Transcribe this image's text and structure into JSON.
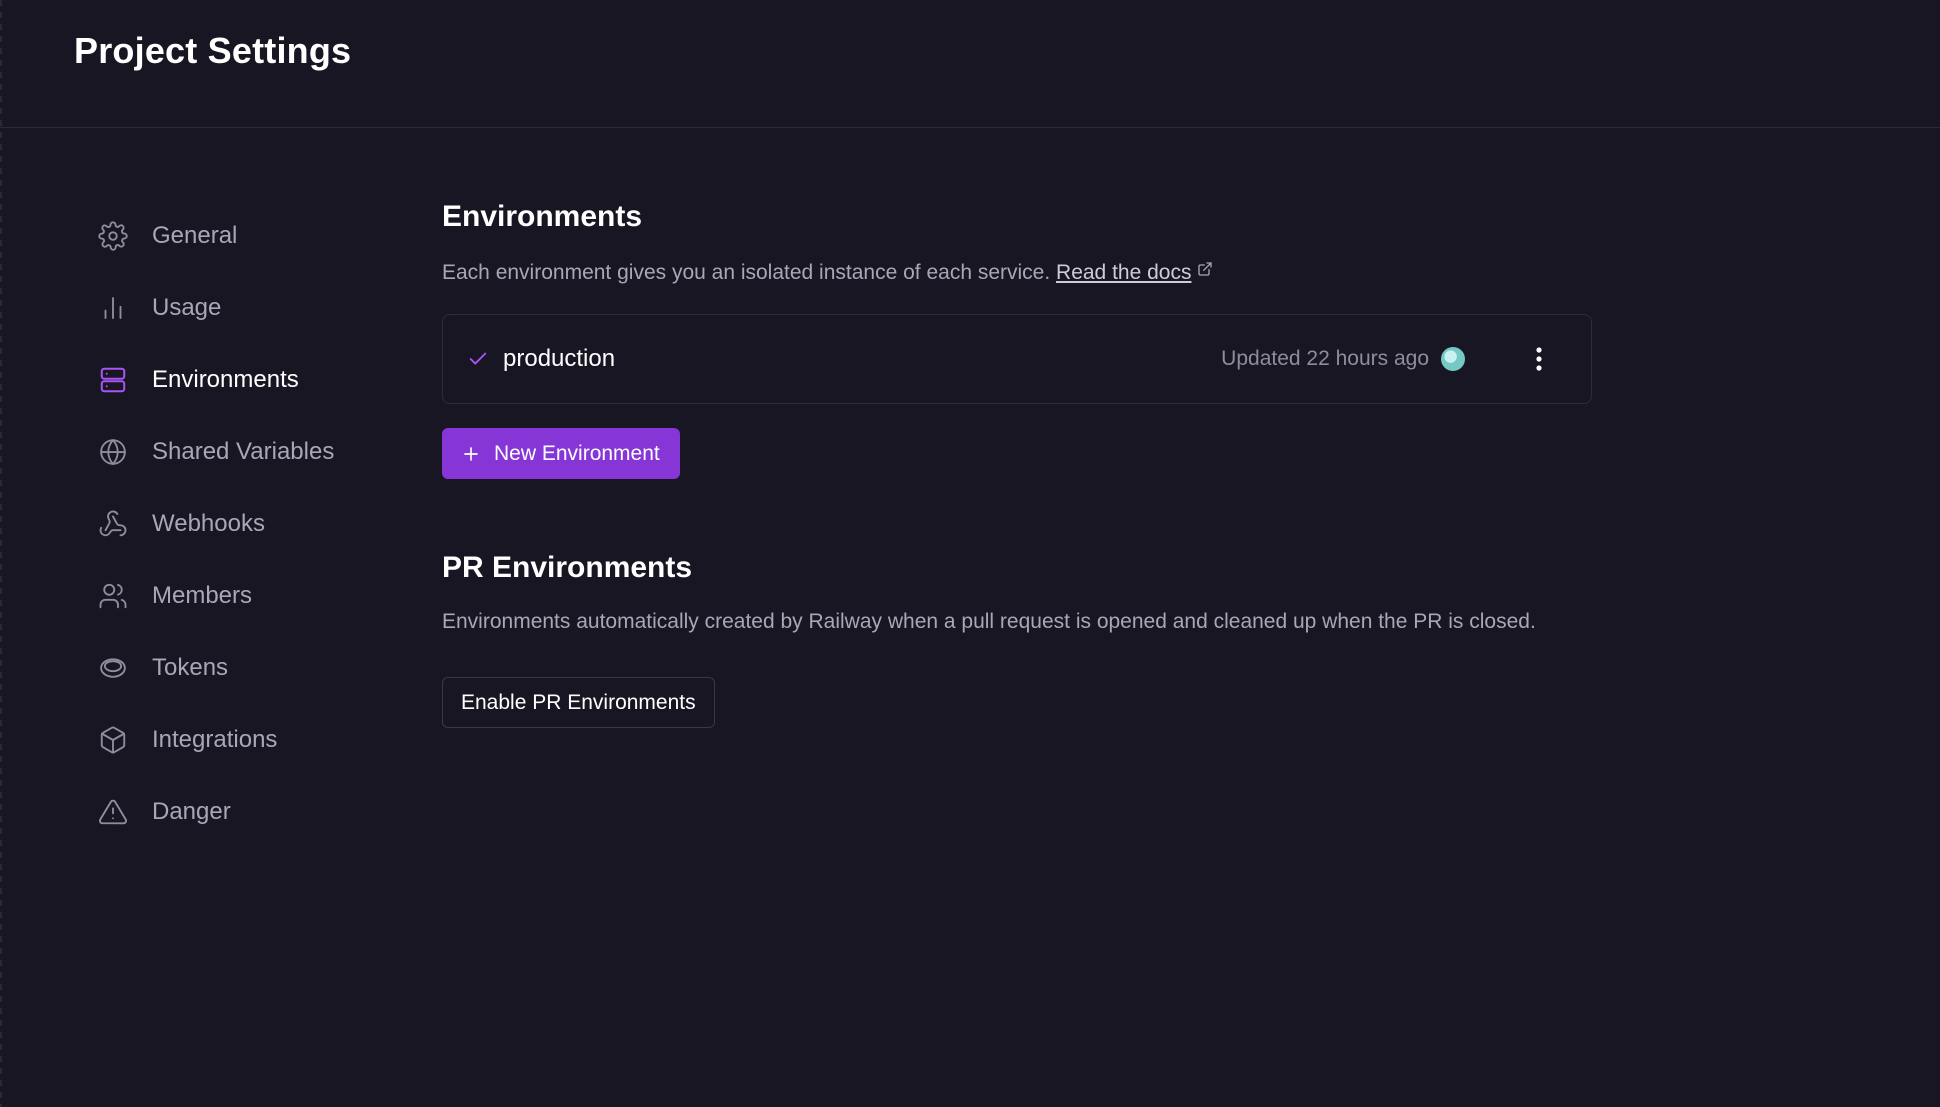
{
  "header": {
    "title": "Project Settings"
  },
  "sidebar": {
    "items": [
      {
        "label": "General",
        "icon": "gear-icon",
        "active": false
      },
      {
        "label": "Usage",
        "icon": "bar-chart-icon",
        "active": false
      },
      {
        "label": "Environments",
        "icon": "server-icon",
        "active": true
      },
      {
        "label": "Shared Variables",
        "icon": "globe-icon",
        "active": false
      },
      {
        "label": "Webhooks",
        "icon": "webhook-icon",
        "active": false
      },
      {
        "label": "Members",
        "icon": "users-icon",
        "active": false
      },
      {
        "label": "Tokens",
        "icon": "coin-icon",
        "active": false
      },
      {
        "label": "Integrations",
        "icon": "box-icon",
        "active": false
      },
      {
        "label": "Danger",
        "icon": "warning-icon",
        "active": false
      }
    ]
  },
  "environments": {
    "title": "Environments",
    "description": "Each environment gives you an isolated instance of each service.",
    "docs_link": "Read the docs",
    "list": [
      {
        "name": "production",
        "updated": "Updated 22 hours ago"
      }
    ],
    "new_button": "New Environment"
  },
  "pr_environments": {
    "title": "PR Environments",
    "description": "Environments automatically created by Railway when a pull request is opened and cleaned up when the PR is closed.",
    "enable_button": "Enable PR Environments"
  },
  "colors": {
    "background": "#181622",
    "accent": "#8635d6",
    "active_icon": "#a855f7",
    "muted_text": "#a9a6b6"
  }
}
